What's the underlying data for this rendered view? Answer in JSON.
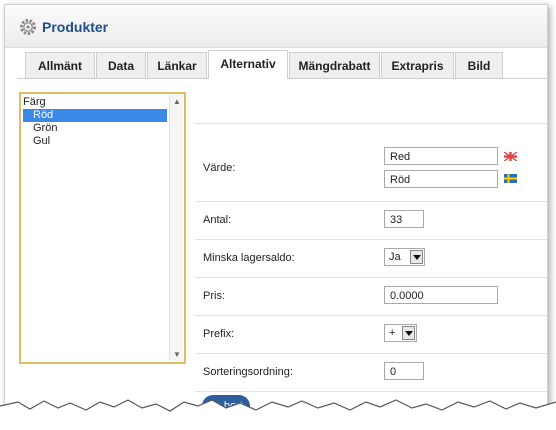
{
  "header": {
    "title": "Produkter",
    "icon": "gear-icon"
  },
  "tabs": [
    {
      "label": "Allmänt",
      "active": false
    },
    {
      "label": "Data",
      "active": false
    },
    {
      "label": "Länkar",
      "active": false
    },
    {
      "label": "Alternativ",
      "active": true
    },
    {
      "label": "Mängdrabatt",
      "active": false
    },
    {
      "label": "Extrapris",
      "active": false
    },
    {
      "label": "Bild",
      "active": false
    }
  ],
  "options_list": {
    "items": [
      {
        "label": "Färg",
        "level": 0,
        "selected": false
      },
      {
        "label": "Röd",
        "level": 1,
        "selected": true
      },
      {
        "label": "Grön",
        "level": 1,
        "selected": false
      },
      {
        "label": "Gul",
        "level": 1,
        "selected": false
      }
    ]
  },
  "form": {
    "varde": {
      "label": "Värde:",
      "value_en": "Red",
      "value_sv": "Röd",
      "flag_en": "uk-flag-icon",
      "flag_sv": "sweden-flag-icon"
    },
    "antal": {
      "label": "Antal:",
      "value": "33"
    },
    "minska": {
      "label": "Minska lagersaldo:",
      "value": "Ja"
    },
    "pris": {
      "label": "Pris:",
      "value": "0.0000"
    },
    "prefix": {
      "label": "Prefix:",
      "value": "+"
    },
    "sortering": {
      "label": "Sorteringsordning:",
      "value": "0"
    }
  },
  "actions": {
    "remove_label": "Ta bort"
  },
  "colors": {
    "accent": "#1f4e8c",
    "selection": "#3b89e6",
    "listbox_border": "#e0b96a",
    "button": "#2d5f9e"
  }
}
